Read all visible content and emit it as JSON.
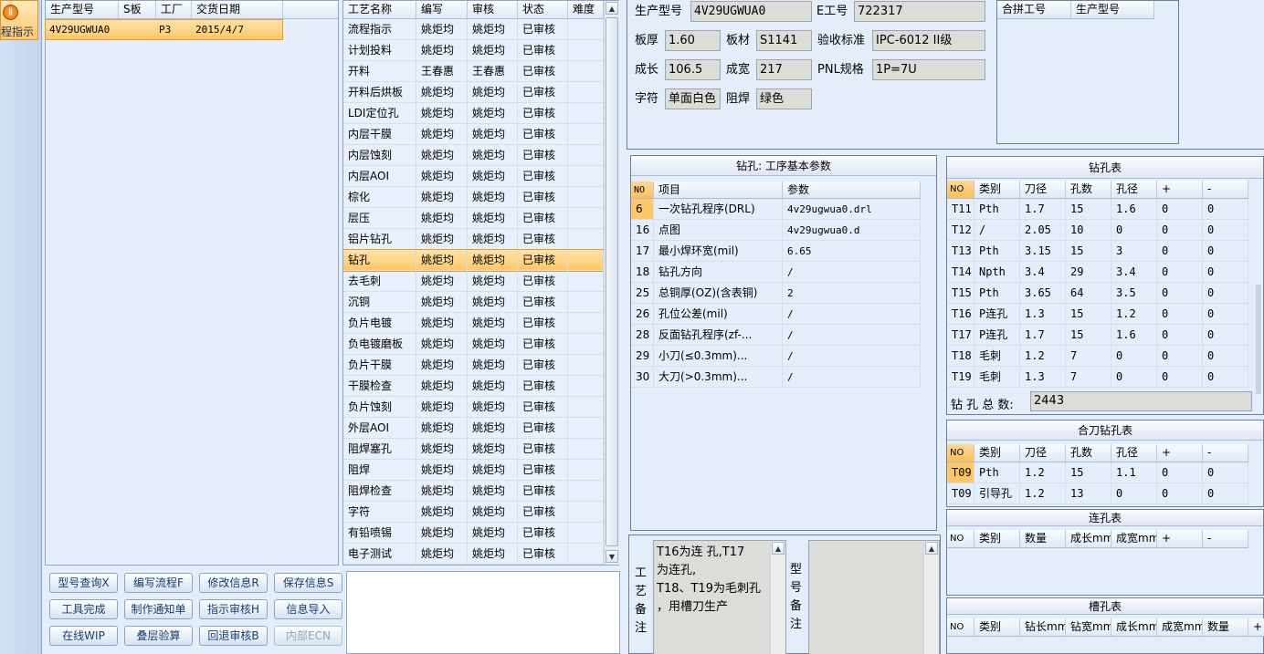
{
  "left_nav": {
    "label": "程指示"
  },
  "product_list": {
    "headers": [
      "生产型号",
      "S板",
      "工厂",
      "交货日期"
    ],
    "rows": [
      [
        "4V29UGWUA0",
        "",
        "P3",
        "2015/4/7"
      ]
    ]
  },
  "buttons": [
    {
      "label": "型号查询X",
      "disabled": false
    },
    {
      "label": "编写流程F",
      "disabled": false
    },
    {
      "label": "修改信息R",
      "disabled": false
    },
    {
      "label": "保存信息S",
      "disabled": false
    },
    {
      "label": "工具完成",
      "disabled": false
    },
    {
      "label": "制作通知单",
      "disabled": false
    },
    {
      "label": "指示审核H",
      "disabled": false
    },
    {
      "label": "信息导入",
      "disabled": false
    },
    {
      "label": "在线WIP",
      "disabled": false
    },
    {
      "label": "叠层验算",
      "disabled": false
    },
    {
      "label": "回退审核B",
      "disabled": false
    },
    {
      "label": "内部ECN",
      "disabled": true
    }
  ],
  "process_table": {
    "headers": [
      "工艺名称",
      "编写",
      "审核",
      "状态",
      "难度"
    ],
    "selected_index": 11,
    "rows": [
      [
        "流程指示",
        "姚炬均",
        "姚炬均",
        "已审核",
        ""
      ],
      [
        "计划投料",
        "姚炬均",
        "姚炬均",
        "已审核",
        ""
      ],
      [
        "开料",
        "王春惠",
        "王春惠",
        "已审核",
        ""
      ],
      [
        "开料后烘板",
        "姚炬均",
        "姚炬均",
        "已审核",
        ""
      ],
      [
        "LDI定位孔",
        "姚炬均",
        "姚炬均",
        "已审核",
        ""
      ],
      [
        "内层干膜",
        "姚炬均",
        "姚炬均",
        "已审核",
        ""
      ],
      [
        "内层蚀刻",
        "姚炬均",
        "姚炬均",
        "已审核",
        ""
      ],
      [
        "内层AOI",
        "姚炬均",
        "姚炬均",
        "已审核",
        ""
      ],
      [
        "棕化",
        "姚炬均",
        "姚炬均",
        "已审核",
        ""
      ],
      [
        "层压",
        "姚炬均",
        "姚炬均",
        "已审核",
        ""
      ],
      [
        "铝片钻孔",
        "姚炬均",
        "姚炬均",
        "已审核",
        ""
      ],
      [
        "钻孔",
        "姚炬均",
        "姚炬均",
        "已审核",
        ""
      ],
      [
        "去毛刺",
        "姚炬均",
        "姚炬均",
        "已审核",
        ""
      ],
      [
        "沉铜",
        "姚炬均",
        "姚炬均",
        "已审核",
        ""
      ],
      [
        "负片电镀",
        "姚炬均",
        "姚炬均",
        "已审核",
        ""
      ],
      [
        "负电镀磨板",
        "姚炬均",
        "姚炬均",
        "已审核",
        ""
      ],
      [
        "负片干膜",
        "姚炬均",
        "姚炬均",
        "已审核",
        ""
      ],
      [
        "干膜检查",
        "姚炬均",
        "姚炬均",
        "已审核",
        ""
      ],
      [
        "负片蚀刻",
        "姚炬均",
        "姚炬均",
        "已审核",
        ""
      ],
      [
        "外层AOI",
        "姚炬均",
        "姚炬均",
        "已审核",
        ""
      ],
      [
        "阻焊塞孔",
        "姚炬均",
        "姚炬均",
        "已审核",
        ""
      ],
      [
        "阻焊",
        "姚炬均",
        "姚炬均",
        "已审核",
        ""
      ],
      [
        "阻焊检查",
        "姚炬均",
        "姚炬均",
        "已审核",
        ""
      ],
      [
        "字符",
        "姚炬均",
        "姚炬均",
        "已审核",
        ""
      ],
      [
        "有铅喷锡",
        "姚炬均",
        "姚炬均",
        "已审核",
        ""
      ],
      [
        "电子测试",
        "姚炬均",
        "姚炬均",
        "已审核",
        ""
      ]
    ]
  },
  "info": {
    "model_label": "生产型号",
    "model": "4V29UGWUA0",
    "eno_label": "E工号",
    "eno": "722317",
    "thickness_label": "板厚",
    "thickness": "1.60",
    "material_label": "板材",
    "material": "S1141",
    "standard_label": "验收标准",
    "standard": "IPC-6012 II级",
    "length_label": "成长",
    "length": "106.5",
    "width_label": "成宽",
    "width": "217",
    "pnl_label": "PNL规格",
    "pnl": "1P=7U",
    "char_label": "字符",
    "char": "单面白色",
    "mask_label": "阻焊",
    "mask": "绿色"
  },
  "combine": {
    "headers": [
      "合拼工号",
      "生产型号"
    ]
  },
  "drill_params": {
    "title": "钻孔: 工序基本参数",
    "headers": [
      "NO",
      "项目",
      "参数"
    ],
    "rows": [
      [
        "6",
        "一次钻孔程序(DRL)",
        "4v29ugwua0.drl"
      ],
      [
        "16",
        "点图",
        "4v29ugwua0.d"
      ],
      [
        "17",
        "最小焊环宽(mil)",
        "6.65"
      ],
      [
        "18",
        "钻孔方向",
        "/"
      ],
      [
        "25",
        "总铜厚(OZ)(含表铜)",
        "2"
      ],
      [
        "26",
        "孔位公差(mil)",
        "/"
      ],
      [
        "28",
        "反面钻孔程序(zf-...",
        "/"
      ],
      [
        "29",
        "小刀(≤0.3mm)...",
        "/"
      ],
      [
        "30",
        "大刀(>0.3mm)...",
        "/"
      ]
    ]
  },
  "drill_table": {
    "title": "钻孔表",
    "headers": [
      "NO",
      "类别",
      "刀径",
      "孔数",
      "孔径",
      "+",
      "-"
    ],
    "rows": [
      [
        "T11",
        "Pth",
        "1.7",
        "15",
        "1.6",
        "0",
        "0"
      ],
      [
        "T12",
        "/",
        "2.05",
        "10",
        "0",
        "0",
        "0"
      ],
      [
        "T13",
        "Pth",
        "3.15",
        "15",
        "3",
        "0",
        "0"
      ],
      [
        "T14",
        "Npth",
        "3.4",
        "29",
        "3.4",
        "0",
        "0"
      ],
      [
        "T15",
        "Pth",
        "3.65",
        "64",
        "3.5",
        "0",
        "0"
      ],
      [
        "T16",
        "P连孔",
        "1.3",
        "15",
        "1.2",
        "0",
        "0"
      ],
      [
        "T17",
        "P连孔",
        "1.7",
        "15",
        "1.6",
        "0",
        "0"
      ],
      [
        "T18",
        "毛刺",
        "1.2",
        "7",
        "0",
        "0",
        "0"
      ],
      [
        "T19",
        "毛刺",
        "1.3",
        "7",
        "0",
        "0",
        "0"
      ]
    ],
    "total_label": "钻 孔 总 数:",
    "total": "2443"
  },
  "combo_drill": {
    "title": "合刀钻孔表",
    "headers": [
      "NO",
      "类别",
      "刀径",
      "孔数",
      "孔径",
      "+",
      "-"
    ],
    "rows": [
      [
        "T09",
        "Pth",
        "1.2",
        "15",
        "1.1",
        "0",
        "0"
      ],
      [
        "T09",
        "引导孔",
        "1.2",
        "13",
        "0",
        "0",
        "0"
      ]
    ]
  },
  "slot_table": {
    "title": "连孔表",
    "headers": [
      "NO",
      "类别",
      "数量",
      "成长mm",
      "成宽mm",
      "+",
      "-"
    ]
  },
  "groove_table": {
    "title": "槽孔表",
    "headers": [
      "NO",
      "类别",
      "钻长mm",
      "钻宽mm",
      "成长mm",
      "成宽mm",
      "数量",
      "+"
    ]
  },
  "notes": {
    "process_label": [
      "工",
      "艺",
      "备",
      "注"
    ],
    "process_text": [
      "T16为连 孔,T17",
      "为连孔,",
      "T18、T19为毛刺孔",
      "，用槽刀生产"
    ],
    "model_label": [
      "型",
      "号",
      "备",
      "注"
    ]
  },
  "colors": {
    "orange": "#ffc766",
    "panel_bg": "#e4eefa",
    "field_bg": "#dcdcd8"
  }
}
